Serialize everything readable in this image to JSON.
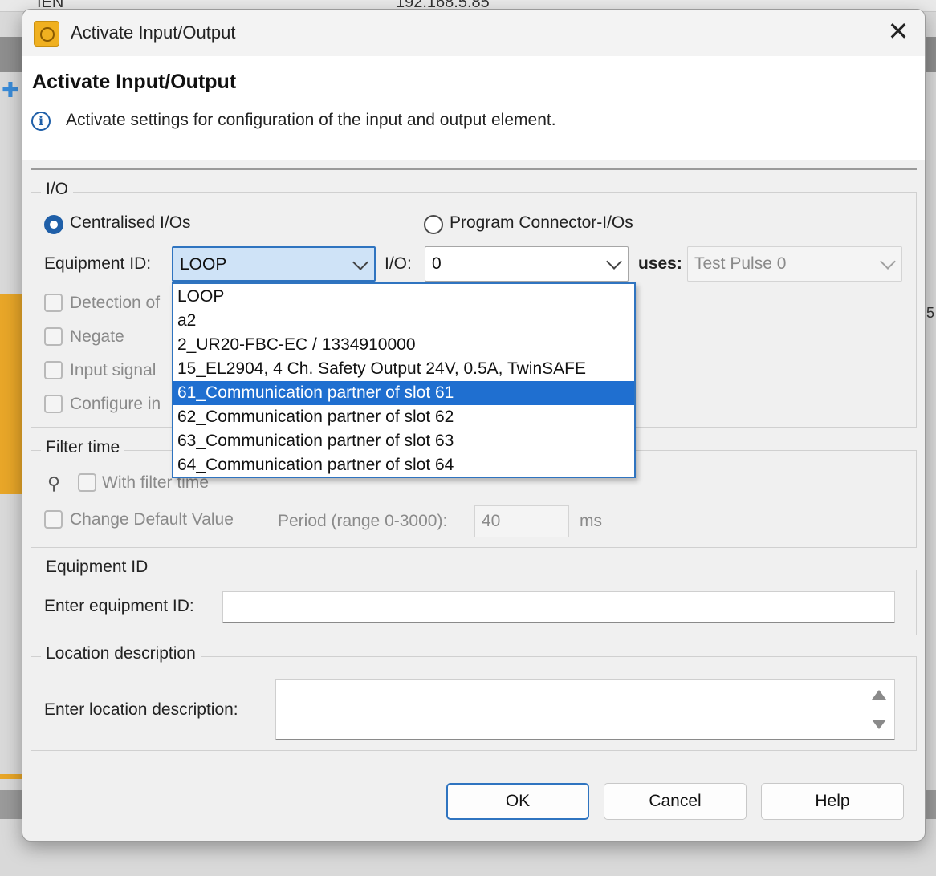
{
  "background": {
    "toolbar_id_fragment": "IEN",
    "toolbar_ip": "192.168.5.85",
    "right_fragment": "5"
  },
  "dialog": {
    "title": "Activate Input/Output",
    "close_glyph": "✕",
    "header_title": "Activate Input/Output",
    "header_description": "Activate settings for configuration of the input and output element.",
    "info_glyph": "i"
  },
  "io_group": {
    "legend": "I/O",
    "radio_centralised": {
      "label": "Centralised I/Os",
      "checked": true
    },
    "radio_program": {
      "label": "Program Connector-I/Os",
      "checked": false
    },
    "equipment_id_label": "Equipment ID:",
    "equipment_id_value": "LOOP",
    "io_label": "I/O:",
    "io_value": "0",
    "uses_label": "uses:",
    "uses_value": "Test Pulse 0",
    "checkboxes": [
      {
        "label": "Detection of",
        "checked": false
      },
      {
        "label": "Negate",
        "checked": false
      },
      {
        "label": "Input signal",
        "checked": false
      },
      {
        "label": "Configure in",
        "checked": false
      }
    ]
  },
  "equipment_dropdown": {
    "options": [
      "LOOP",
      "a2",
      "2_UR20-FBC-EC / 1334910000",
      "15_EL2904, 4 Ch. Safety Output 24V, 0.5A, TwinSAFE",
      "61_Communication partner of slot 61",
      "62_Communication partner of slot 62",
      "63_Communication partner of slot 63",
      "64_Communication partner of slot 64"
    ],
    "highlighted_index": 4
  },
  "filter_group": {
    "legend": "Filter time",
    "with_filter_time_label": "With filter time",
    "change_default_label": "Change Default Value",
    "period_label": "Period (range 0-3000):",
    "period_value": "40",
    "period_unit": "ms"
  },
  "equipment_group": {
    "legend": "Equipment ID",
    "label": "Enter equipment ID:",
    "value": ""
  },
  "location_group": {
    "legend": "Location description",
    "label": "Enter location description:",
    "value": ""
  },
  "buttons": {
    "ok": "OK",
    "cancel": "Cancel",
    "help": "Help"
  }
}
